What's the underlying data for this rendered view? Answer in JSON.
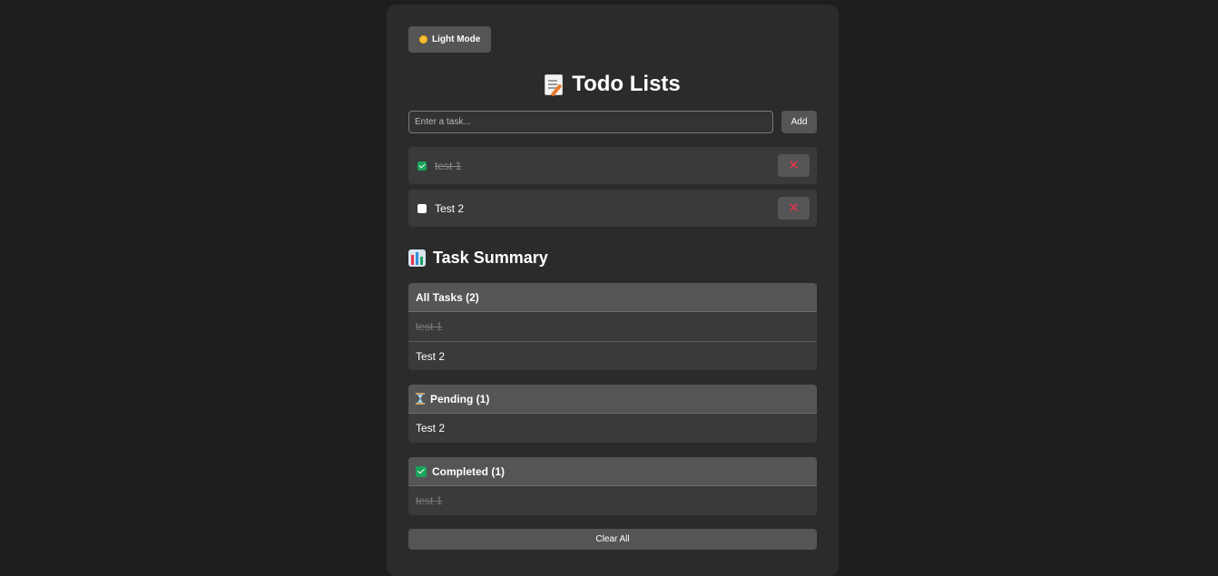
{
  "theme_toggle": {
    "label": "Light Mode",
    "icon": "sun-icon"
  },
  "header": {
    "title": "Todo Lists",
    "icon": "memo-icon"
  },
  "add_form": {
    "placeholder": "Enter a task...",
    "value": "",
    "add_label": "Add"
  },
  "todos": [
    {
      "text": "test 1",
      "completed": true,
      "delete_icon": "close-icon"
    },
    {
      "text": "Test 2",
      "completed": false,
      "delete_icon": "close-icon"
    }
  ],
  "summary": {
    "title": "Task Summary",
    "icon": "bar-chart-icon",
    "groups": {
      "all": {
        "label": "All Tasks (2)",
        "items": [
          "test 1",
          "Test 2"
        ]
      },
      "pending": {
        "label": "Pending (1)",
        "icon": "hourglass-icon",
        "items": [
          "Test 2"
        ]
      },
      "completed": {
        "label": "Completed (1)",
        "icon": "check-icon",
        "items": [
          "test 1"
        ]
      }
    }
  },
  "clear_all_label": "Clear All",
  "colors": {
    "page_bg": "#1e1e1e",
    "card_bg": "#2b2b2b",
    "button_bg": "#555555",
    "item_bg": "#3a3a3a",
    "delete_accent": "#e8334a",
    "done_accent": "#1aa35a"
  }
}
